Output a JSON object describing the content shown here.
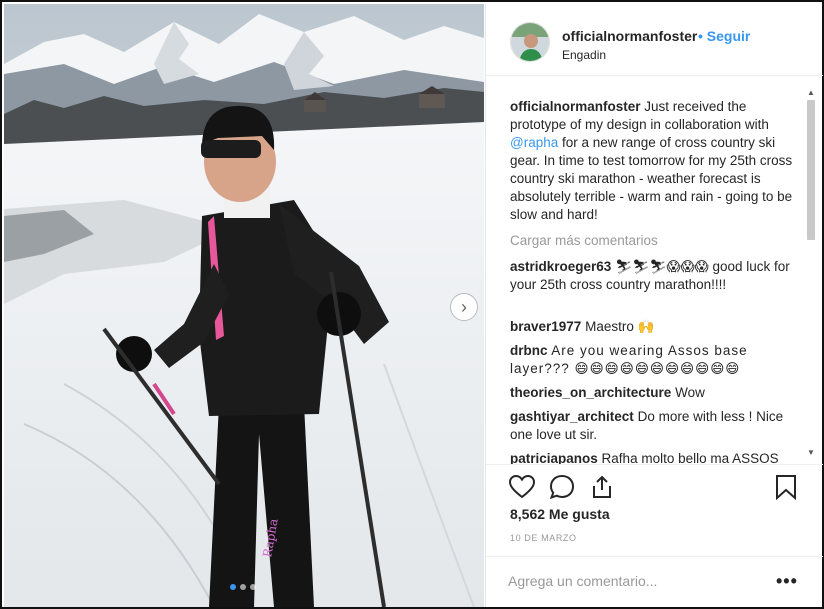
{
  "header": {
    "username": "officialnormanfoster",
    "separator": "•",
    "follow_label": "Seguir",
    "location": "Engadin"
  },
  "caption": {
    "username": "officialnormanfoster",
    "text_before_mention": "Just received the prototype of my design in collaboration with",
    "mention": "@rapha",
    "text_after_mention": "for a new range of cross country ski gear. In time to test tomorrow for my 25th cross country ski marathon - weather forecast is absolutely terrible - warm and rain - going to be slow and hard!"
  },
  "load_more_label": "Cargar más comentarios",
  "comments": [
    {
      "username": "astridkroeger63",
      "text": "⛷⛷⛷😱😱😱 good luck for your 25th cross country marathon!!!!"
    },
    {
      "username": "braver1977",
      "text": "Maestro 🙌"
    },
    {
      "username": "drbnc",
      "text": "Are you wearing Assos base layer??? 😄😄😄😄😄😄😄😄😄😄😄"
    },
    {
      "username": "theories_on_architecture",
      "text": "Wow"
    },
    {
      "username": "gashtiyar_architect",
      "text": "Do more with less ! Nice one love ut sir."
    },
    {
      "username": "patriciapanos",
      "text": "Rafha molto bello ma ASSOS"
    }
  ],
  "likes_text": "8,562 Me gusta",
  "date_text": "10 DE MARZO",
  "add_comment": {
    "placeholder": "Agrega un comentario..."
  },
  "more_label": "•••",
  "photo": {
    "jersey_brand_text": "Rapha"
  },
  "icons": {
    "next": "chevron-right-icon",
    "like": "heart-icon",
    "comment": "speech-bubble-icon",
    "share": "share-icon",
    "save": "bookmark-icon"
  },
  "colors": {
    "accent": "#3897f0",
    "text": "#262626",
    "muted": "#999999"
  }
}
